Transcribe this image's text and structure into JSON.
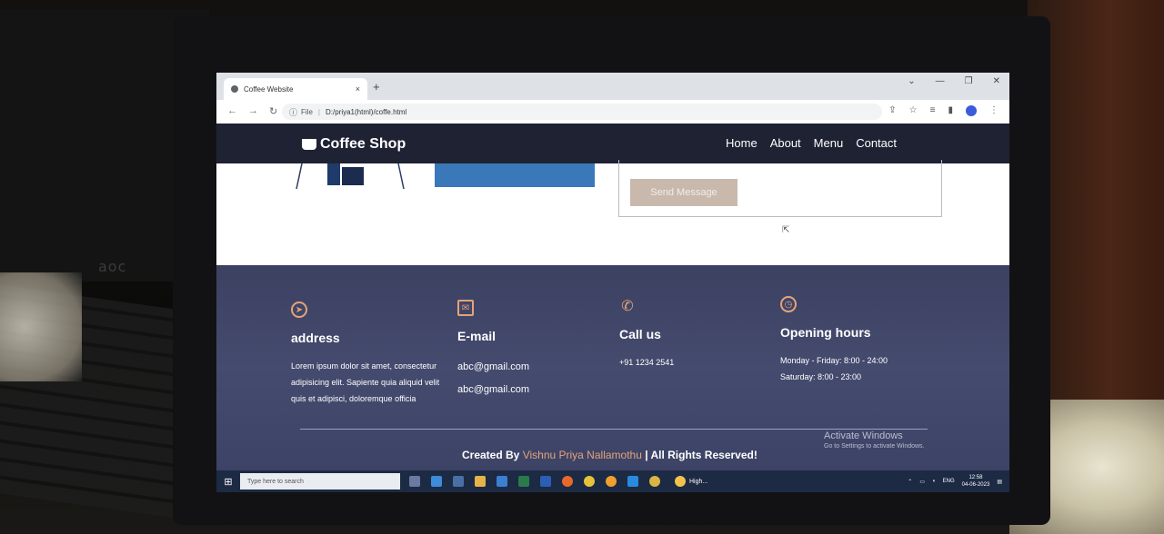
{
  "browser": {
    "tab_title": "Coffee Website",
    "tab_close": "×",
    "new_tab": "+",
    "url_info": "ⓘ",
    "url_scheme": "File",
    "url_path": "D:/priya1(html)/coffe.html"
  },
  "site": {
    "brand": "Coffee Shop",
    "nav": [
      "Home",
      "About",
      "Menu",
      "Contact"
    ],
    "send_button": "Send Message"
  },
  "footer": {
    "address": {
      "title": "address",
      "text": "Lorem ipsum dolor sit amet, consectetur adipisicing elit. Sapiente quia aliquid velit quis et adipisci, doloremque officia"
    },
    "email": {
      "title": "E-mail",
      "items": [
        "abc@gmail.com",
        "abc@gmail.com"
      ]
    },
    "call": {
      "title": "Call us",
      "number": "+91 1234 2541"
    },
    "hours": {
      "title": "Opening hours",
      "lines": [
        "Monday - Friday: 8:00 - 24:00",
        "Saturday: 8:00 - 23:00"
      ]
    },
    "credit_prefix": "Created By ",
    "credit_name": "Vishnu Priya Nallamothu",
    "credit_suffix": " | All Rights Reserved!",
    "activate_title": "Activate Windows",
    "activate_sub": "Go to Settings to activate Windows."
  },
  "taskbar": {
    "search_placeholder": "Type here to search",
    "weather": "High...",
    "lang": "ENG",
    "time": "12:58",
    "date": "04-06-2023"
  },
  "background": {
    "monitor_brand": "aoc"
  },
  "colors": {
    "accent": "#e4a37a",
    "header": "#1f2233",
    "footer": "#41466a"
  }
}
